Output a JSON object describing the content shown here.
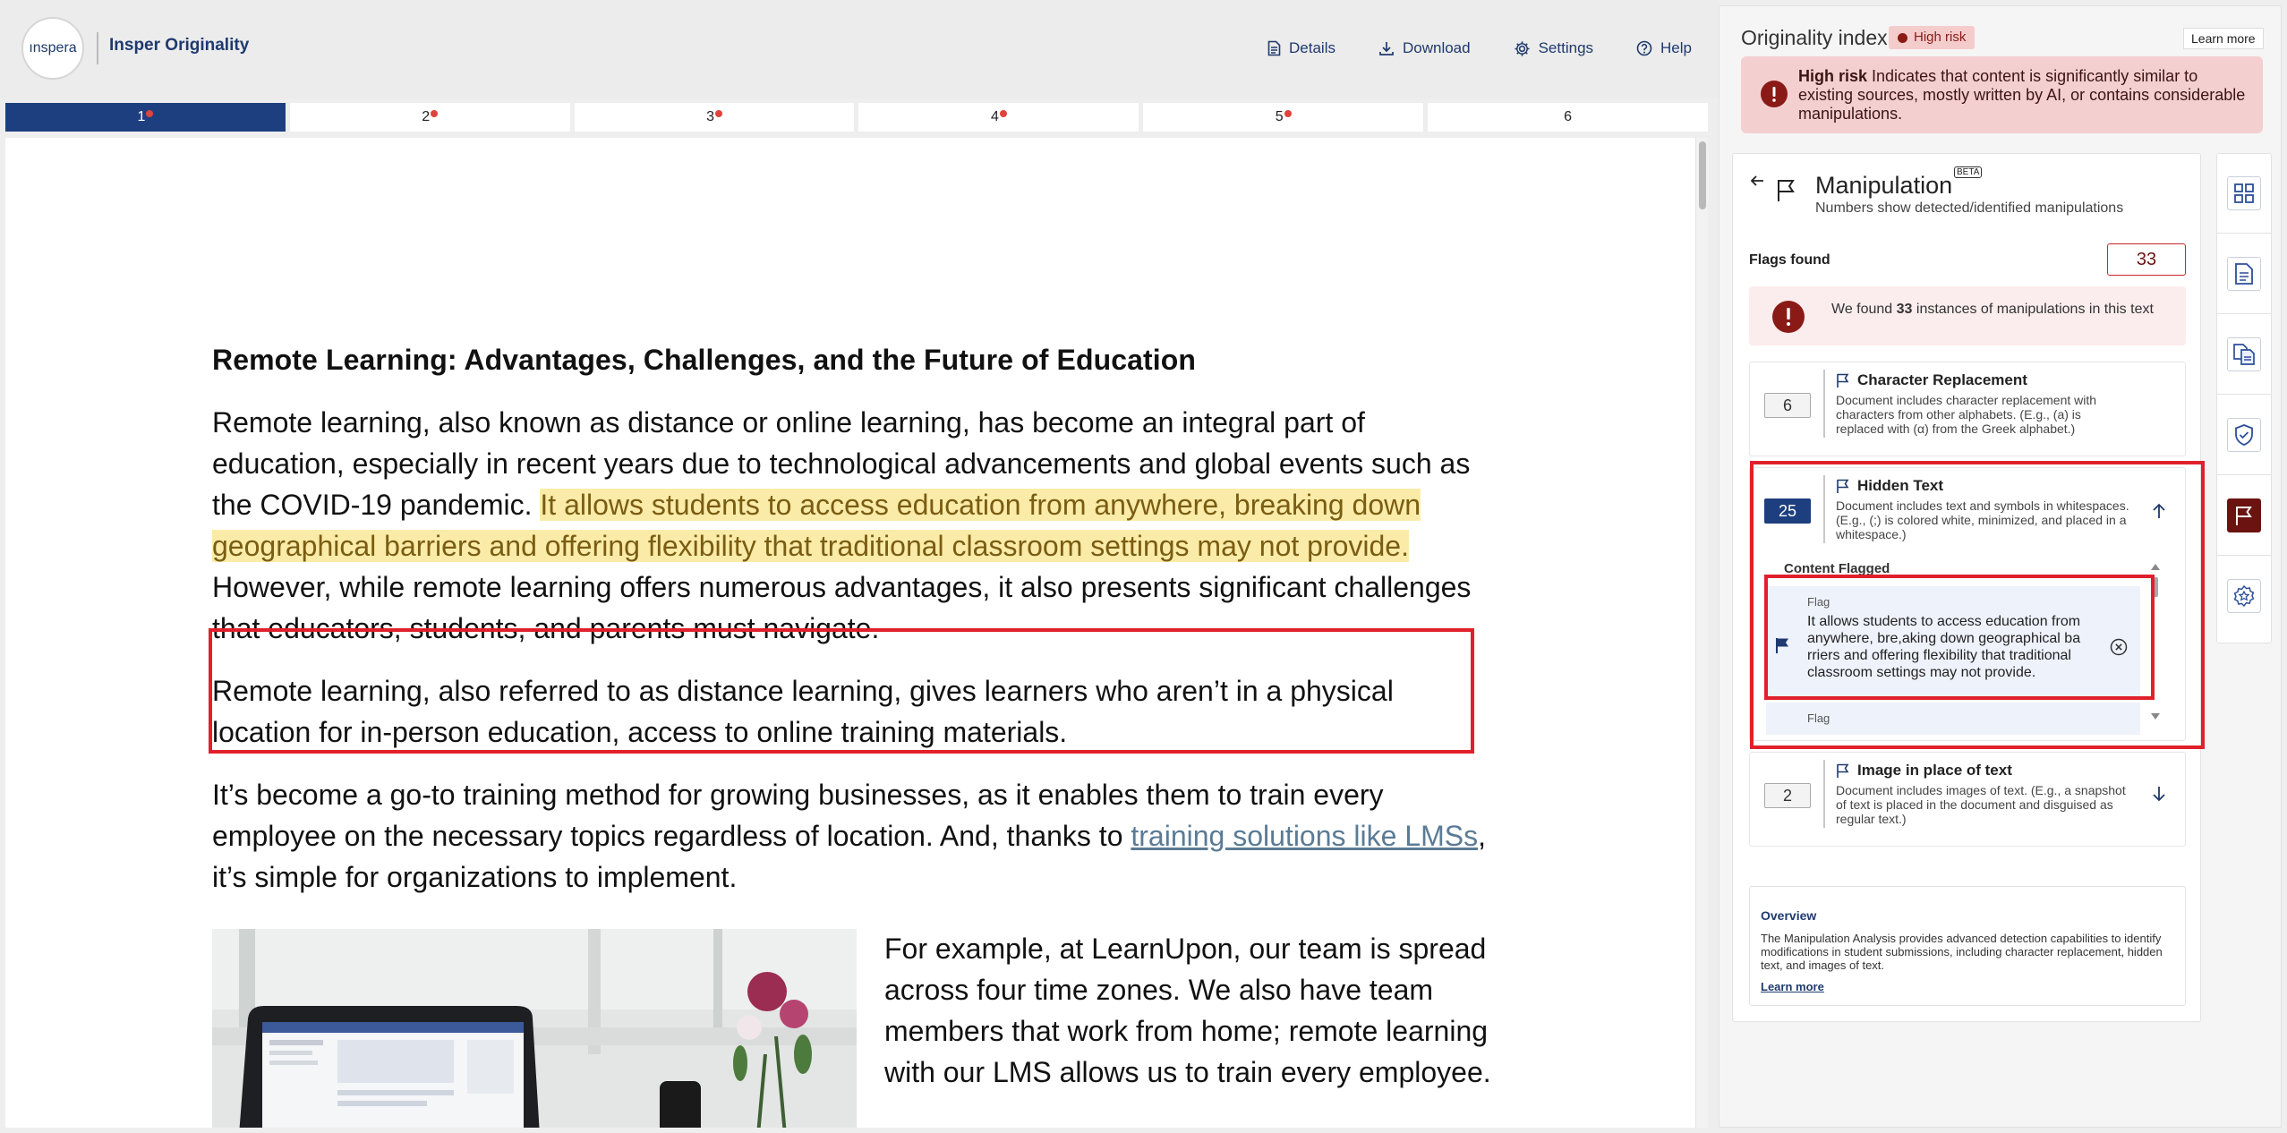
{
  "header": {
    "logo_text": "ınspera",
    "brand": "Insper Originality",
    "actions": [
      {
        "label": "Details",
        "icon": "document-icon"
      },
      {
        "label": "Download",
        "icon": "download-icon"
      },
      {
        "label": "Settings",
        "icon": "gear-icon"
      },
      {
        "label": "Help",
        "icon": "help-icon"
      }
    ]
  },
  "page_tabs": [
    {
      "label": "1",
      "flagged": true,
      "active": true
    },
    {
      "label": "2",
      "flagged": true
    },
    {
      "label": "3",
      "flagged": true
    },
    {
      "label": "4",
      "flagged": true
    },
    {
      "label": "5",
      "flagged": true
    },
    {
      "label": "6",
      "flagged": false
    }
  ],
  "document": {
    "title": "Remote Learning: Advantages, Challenges, and the Future of Education",
    "p1_before": "Remote learning, also known as distance or online learning, has become an integral part of education, especially in recent years due to technological advancements and global events such as the COVID-19 pandemic. ",
    "p1_highlight": "It allows students to access education from anywhere, breaking down geographical barriers and offering flexibility that traditional classroom settings may not provide.",
    "p1_after": " However, while remote learning offers numerous advantages, it also presents significant challenges that educators, students, and parents must navigate.",
    "p2": "Remote learning, also referred to as distance learning, gives learners who aren’t in a physical location for in-person education, access to online training materials.",
    "p3_before": "It’s become a go-to training method for growing businesses, as it enables them to train every employee on the necessary topics regardless of location. And, thanks to ",
    "p3_link": "training solutions like LMSs",
    "p3_after": ", it’s simple for organizations to implement.",
    "p4": "For example, at LearnUpon, our team is spread across four time zones. We also have team members that work from home; remote learning with our LMS allows us to train every employee."
  },
  "panel": {
    "title": "Originality index",
    "risk_badge": "High risk",
    "learn_more": "Learn more",
    "alert_bold": "High risk",
    "alert_text": " Indicates that content is significantly similar to existing sources, mostly written by AI, or contains considerable manipulations.",
    "manipulation": {
      "title": "Manipulation",
      "beta": "BETA",
      "subtitle": "Numbers show detected/identified manipulations",
      "flags_label": "Flags found",
      "flags_count": "33",
      "found_pre": "We found ",
      "found_count": "33",
      "found_post": " instances of manipulations in this text",
      "categories": [
        {
          "count": "6",
          "title": "Character Replacement",
          "desc": "Document includes character replacement with characters from other alphabets. (E.g., (a) is replaced with (α) from the Greek alphabet.)"
        },
        {
          "count": "25",
          "title": "Hidden Text",
          "desc": "Document includes text and symbols in whitespaces. (E.g., (;) is colored white, minimized, and placed in a whitespace.)"
        },
        {
          "count": "2",
          "title": "Image in place of text",
          "desc": "Document includes images of text. (E.g., a snapshot of text is placed in the document and disguised as regular text.)"
        }
      ],
      "content_flagged_label": "Content Flagged",
      "flags": [
        {
          "label": "Flag",
          "text": "It allows students to access education from anywhere, bre,aking down geographical ba rriers and offering flexibility that traditional classroom settings may not provide."
        },
        {
          "label": "Flag",
          "text": ""
        }
      ]
    },
    "overview": {
      "title": "Overview",
      "text": "The Manipulation Analysis provides advanced detection capabilities to identify modifications in student submissions, including character replacement, hidden text, and images of text.",
      "link": "Learn more"
    }
  },
  "colors": {
    "navy": "#1e3f7f",
    "risk_red": "#8a1a16",
    "flag_outline": "#e0202a",
    "highlight": "#faeca8"
  }
}
